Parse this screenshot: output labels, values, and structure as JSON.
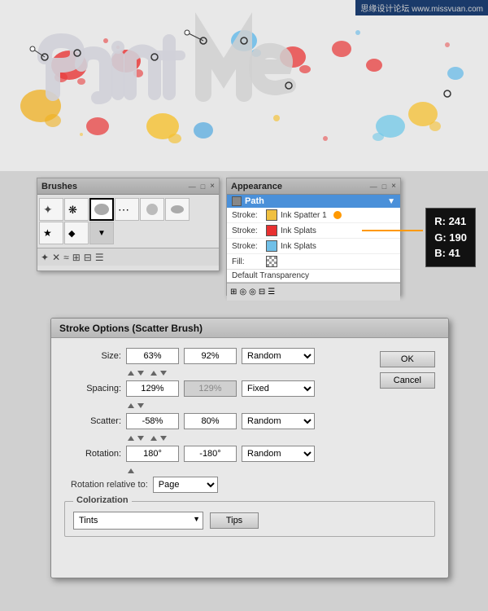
{
  "banner": {
    "text": "思缘设计论坛 www.missvuan.com"
  },
  "brushes_panel": {
    "title": "Brushes",
    "close": "×",
    "minimize": "—",
    "maximize": "□"
  },
  "appearance_panel": {
    "title": "Appearance",
    "close": "×",
    "path_label": "Path",
    "stroke1_label": "Stroke:",
    "stroke1_name": "Ink Spatter 1",
    "stroke2_label": "Stroke:",
    "stroke2_name": "Ink Splats",
    "stroke3_label": "Stroke:",
    "stroke3_name": "Ink Splats",
    "fill_label": "Fill:",
    "transparency_label": "Default Transparency"
  },
  "color_tooltip": {
    "r_label": "R:",
    "r_value": "241",
    "g_label": "G:",
    "g_value": "190",
    "b_label": "B:",
    "b_value": "41"
  },
  "stroke_dialog": {
    "title": "Stroke Options (Scatter Brush)",
    "size_label": "Size:",
    "size_min": "63%",
    "size_max": "92%",
    "size_dropdown": "Random",
    "spacing_label": "Spacing:",
    "spacing_min": "129%",
    "spacing_max": "129%",
    "spacing_dropdown": "Fixed",
    "scatter_label": "Scatter:",
    "scatter_min": "-58%",
    "scatter_max": "80%",
    "scatter_dropdown": "Random",
    "rotation_label": "Rotation:",
    "rotation_min": "180°",
    "rotation_max": "-180°",
    "rotation_dropdown": "Random",
    "rotation_relative_label": "Rotation relative to:",
    "rotation_relative_dropdown": "Page",
    "colorization_title": "Colorization",
    "tints_label": "Tints",
    "tips_btn": "Tips",
    "ok_btn": "OK",
    "cancel_btn": "Cancel"
  }
}
